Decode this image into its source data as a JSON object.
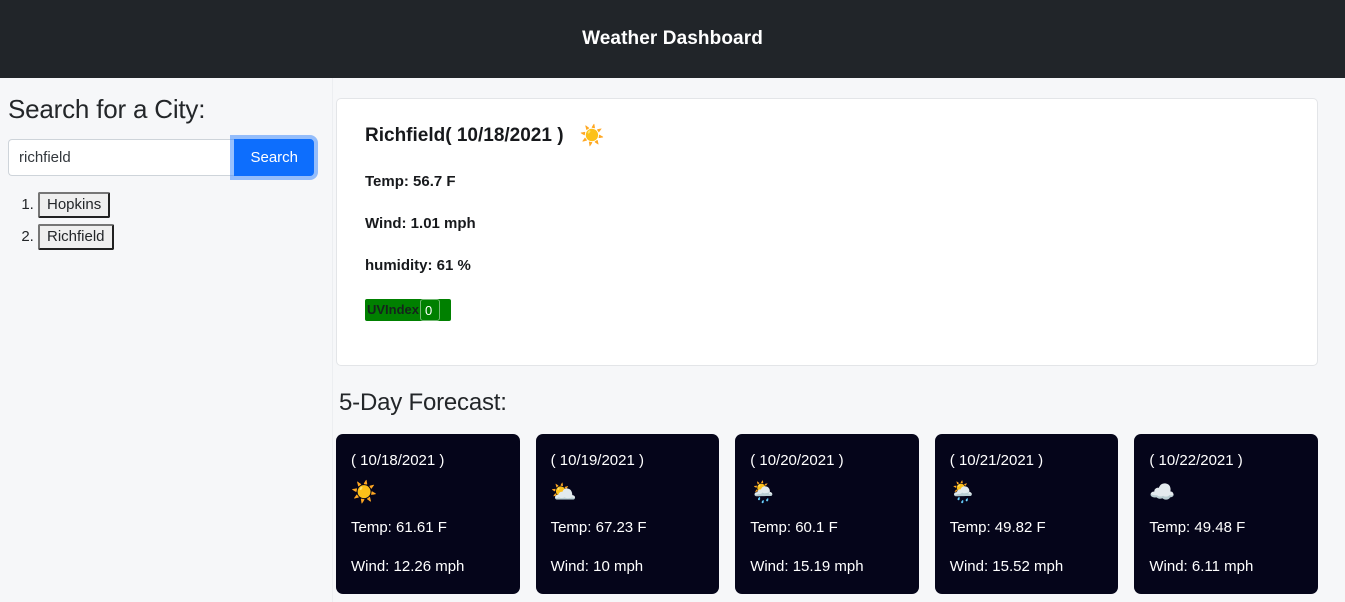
{
  "header": {
    "title": "Weather Dashboard"
  },
  "sidebar": {
    "heading": "Search for a City:",
    "search": {
      "value": "richfield",
      "placeholder": "",
      "button_label": "Search"
    },
    "history": [
      {
        "label": "Hopkins"
      },
      {
        "label": "Richfield"
      }
    ]
  },
  "current": {
    "title": "Richfield( 10/18/2021 )",
    "icon": "☀️",
    "icon_name": "sun-icon",
    "temp": "Temp: 56.7 F",
    "wind": "Wind: 1.01 mph",
    "humidity": "humidity: 61 %",
    "uv_label": "UVIndex",
    "uv_value": "0",
    "uv_color": "#008000"
  },
  "forecast": {
    "heading": "5-Day Forecast:",
    "cards": [
      {
        "date": "( 10/18/2021 )",
        "icon": "☀️",
        "icon_name": "sun-icon",
        "temp": "Temp: 61.61 F",
        "wind": "Wind: 12.26 mph"
      },
      {
        "date": "( 10/19/2021 )",
        "icon": "⛅",
        "icon_name": "sun-behind-cloud-icon",
        "temp": "Temp: 67.23 F",
        "wind": "Wind: 10 mph"
      },
      {
        "date": "( 10/20/2021 )",
        "icon": "🌦️",
        "icon_name": "sun-behind-rain-cloud-icon",
        "temp": "Temp: 60.1 F",
        "wind": "Wind: 15.19 mph"
      },
      {
        "date": "( 10/21/2021 )",
        "icon": "🌦️",
        "icon_name": "sun-behind-rain-cloud-icon",
        "temp": "Temp: 49.82 F",
        "wind": "Wind: 15.52 mph"
      },
      {
        "date": "( 10/22/2021 )",
        "icon": "☁️",
        "icon_name": "cloud-icon",
        "temp": "Temp: 49.48 F",
        "wind": "Wind: 6.11 mph"
      }
    ]
  }
}
